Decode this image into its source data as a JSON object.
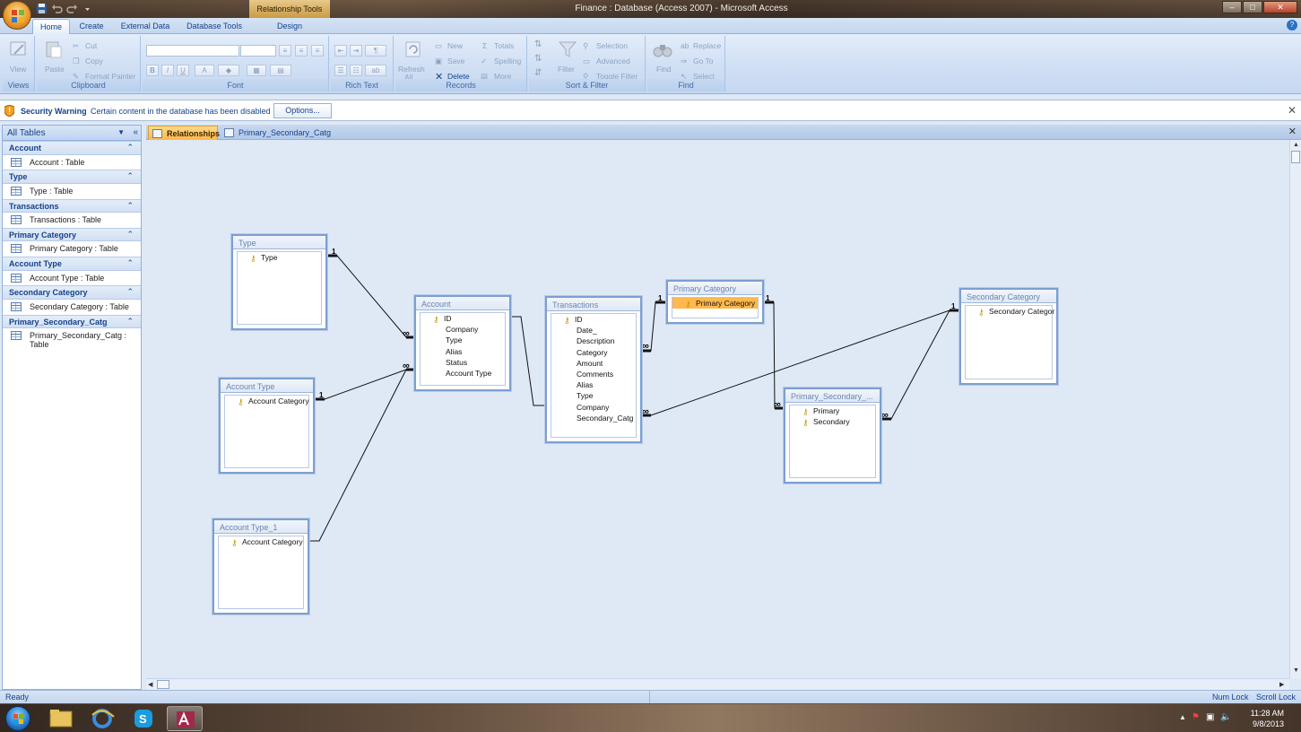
{
  "titlebar": {
    "context_tab": "Relationship Tools",
    "title": "Finance : Database (Access 2007) - Microsoft Access",
    "minimize": "–",
    "maximize": "□",
    "close": "✕"
  },
  "ribbon_tabs": [
    {
      "label": "Home"
    },
    {
      "label": "Create"
    },
    {
      "label": "External Data"
    },
    {
      "label": "Database Tools"
    },
    {
      "label": "Design"
    }
  ],
  "ribbon": {
    "views": {
      "label": "Views",
      "view": "View"
    },
    "clipboard": {
      "label": "Clipboard",
      "paste": "Paste",
      "cut": "Cut",
      "copy": "Copy",
      "format_painter": "Format Painter"
    },
    "font": {
      "label": "Font"
    },
    "rich_text": {
      "label": "Rich Text"
    },
    "records": {
      "label": "Records",
      "refresh": "Refresh",
      "refresh_sub": "All",
      "new": "New",
      "save": "Save",
      "delete": "Delete",
      "totals": "Totals",
      "spelling": "Spelling",
      "more": "More"
    },
    "sort_filter": {
      "label": "Sort & Filter",
      "filter": "Filter",
      "selection": "Selection",
      "advanced": "Advanced",
      "toggle_filter": "Toggle Filter"
    },
    "find": {
      "label": "Find",
      "find": "Find",
      "replace": "Replace",
      "goto": "Go To",
      "select": "Select"
    }
  },
  "security": {
    "title": "Security Warning",
    "message": "Certain content in the database has been disabled",
    "options": "Options..."
  },
  "nav": {
    "header": "All Tables",
    "groups": [
      {
        "name": "Account",
        "item": "Account : Table"
      },
      {
        "name": "Type",
        "item": "Type : Table"
      },
      {
        "name": "Transactions",
        "item": "Transactions : Table"
      },
      {
        "name": "Primary Category",
        "item": "Primary Category : Table"
      },
      {
        "name": "Account Type",
        "item": "Account Type : Table"
      },
      {
        "name": "Secondary Category",
        "item": "Secondary Category : Table"
      },
      {
        "name": "Primary_Secondary_Catg",
        "item": "Primary_Secondary_Catg : Table"
      }
    ]
  },
  "doc_tabs": [
    {
      "label": "Relationships"
    },
    {
      "label": "Primary_Secondary_Catg"
    }
  ],
  "tables": {
    "type": {
      "title": "Type",
      "fields": [
        "Type"
      ]
    },
    "account_type": {
      "title": "Account Type",
      "fields": [
        "Account Category"
      ]
    },
    "account_type_1": {
      "title": "Account Type_1",
      "fields": [
        "Account Category"
      ]
    },
    "account": {
      "title": "Account",
      "fields": [
        "ID",
        "Company",
        "Type",
        "Alias",
        "Status",
        "Account Type"
      ]
    },
    "transactions": {
      "title": "Transactions",
      "fields": [
        "ID",
        "Date_",
        "Description",
        "Category",
        "Amount",
        "Comments",
        "Alias",
        "Type",
        "Company",
        "Secondary_Catg"
      ]
    },
    "primary_category": {
      "title": "Primary Category",
      "fields": [
        "Primary Category"
      ]
    },
    "primary_secondary": {
      "title": "Primary_Secondary_...",
      "fields": [
        "Primary",
        "Secondary"
      ]
    },
    "secondary_category": {
      "title": "Secondary Category",
      "fields": [
        "Secondary Categor"
      ]
    }
  },
  "relationship_labels": {
    "one": "1",
    "many": "∞"
  },
  "status": {
    "text": "Ready",
    "numlock": "Num Lock",
    "scrolllock": "Scroll Lock"
  },
  "taskbar": {
    "time": "11:28 AM",
    "date": "9/8/2013"
  }
}
